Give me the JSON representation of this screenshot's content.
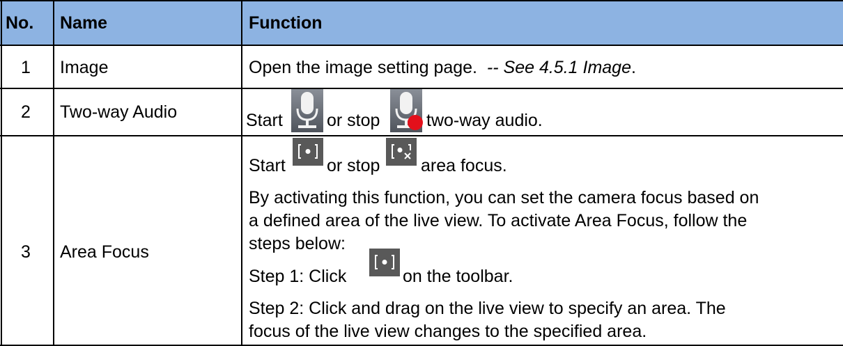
{
  "table": {
    "headers": {
      "no": "No.",
      "name": "Name",
      "function": "Function"
    },
    "header_color": "#8db3e2",
    "rows": [
      {
        "no": "1",
        "name": "Image",
        "function": {
          "text": "Open the image setting page.",
          "ref": "-- See 4.5.1 Image",
          "ref_end": "."
        }
      },
      {
        "no": "2",
        "name": "Two-way Audio",
        "function": {
          "start": "Start",
          "or_stop": "or stop",
          "rest": "two-way audio.",
          "icons": [
            "microphone-icon",
            "microphone-stop-icon"
          ]
        }
      },
      {
        "no": "3",
        "name": "Area Focus",
        "function": {
          "start": "Start",
          "or_stop": "or stop",
          "rest": "area focus.",
          "desc_line1": "By activating this function, you can set the camera focus based on",
          "desc_line2": "a defined area of the live view. To activate Area Focus, follow the",
          "desc_line3": "steps below:",
          "step1_a": "Step 1: Click",
          "step1_b": "on the toolbar.",
          "step2_line1": "Step 2: Click and drag on the live view to specify an area. The",
          "step2_line2": "focus of the live view changes to the specified area.",
          "icons": [
            "area-focus-icon",
            "area-focus-stop-icon"
          ]
        }
      }
    ]
  }
}
